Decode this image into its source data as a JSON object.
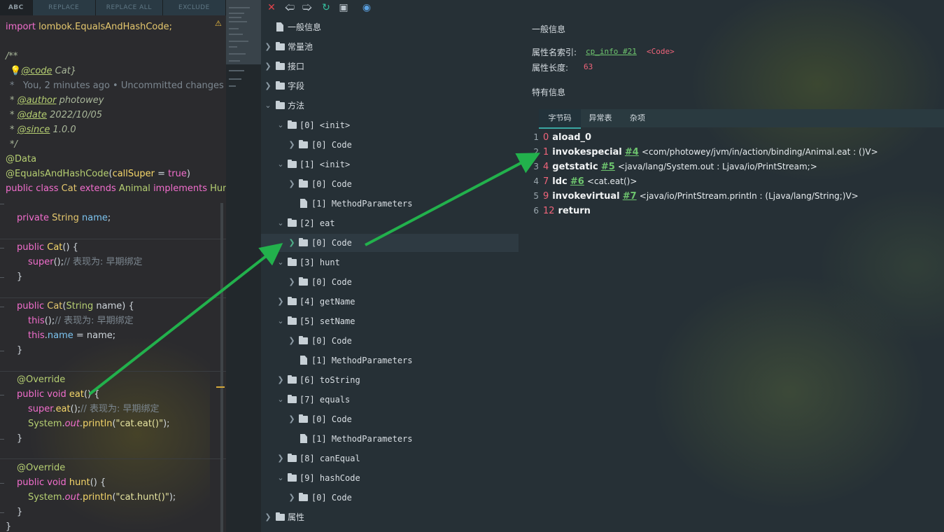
{
  "find_bar": {
    "abc": "ABC",
    "replace": "REPLACE",
    "replace_all": "REPLACE ALL",
    "exclude": "EXCLUDE"
  },
  "code": {
    "import_kw": "import",
    "import_path": " lombok.EqualsAndHashCode;",
    "doc_open": "/**",
    "doc_code_tag": "@code",
    "doc_code_val": " Cat}",
    "blame": "*   You, 2 minutes ago • Uncommitted changes",
    "author_tag": "@author",
    "author_val": " photowey",
    "date_tag": "@date",
    "date_val": " 2022/10/05",
    "since_tag": "@since",
    "since_val": " 1.0.0",
    "doc_close": "*/",
    "ann_data": "@Data",
    "ann_eq": "@EqualsAndHashCode",
    "ann_eq_arg_name": "callSuper",
    "ann_eq_arg_val": "true",
    "class_mod": "public class",
    "class_name": "Cat",
    "extends_kw": "extends",
    "super_name": "Animal",
    "impl_kw": "implements",
    "iface_name": "Hunt",
    "field_mod": "private",
    "field_type": "String",
    "field_name": "name",
    "ctor_mod": "public",
    "ctor_name": "Cat",
    "super_call": "super",
    "comment_early": "// 表现为: 早期绑定",
    "this_call": "this",
    "param_type": "String",
    "param_name": "name",
    "this_kw": "this",
    "override": "@Override",
    "void_kw": "public void",
    "eat": "eat",
    "hunt": "hunt",
    "system": "System",
    "out": "out",
    "println": "println",
    "str_eat": "\"cat.eat()\"",
    "str_hunt": "\"cat.hunt()\"",
    "close_brace": "}"
  },
  "tree": {
    "general": "一般信息",
    "const_pool": "常量池",
    "interfaces": "接口",
    "fields": "字段",
    "methods": "方法",
    "m0": "[0] <init>",
    "m0c": "[0] Code",
    "m1": "[1] <init>",
    "m1c": "[0] Code",
    "m1p": "[1] MethodParameters",
    "m2": "[2] eat",
    "m2c": "[0] Code",
    "m3": "[3] hunt",
    "m3c": "[0] Code",
    "m4": "[4] getName",
    "m5": "[5] setName",
    "m5c": "[0] Code",
    "m5p": "[1] MethodParameters",
    "m6": "[6] toString",
    "m7": "[7] equals",
    "m7c": "[0] Code",
    "m7p": "[1] MethodParameters",
    "m8": "[8] canEqual",
    "m9": "[9] hashCode",
    "m9c": "[0] Code",
    "attrs": "属性"
  },
  "panel": {
    "general_title": "一般信息",
    "name_index_label": "属性名索引:",
    "name_index_link": "cp_info #21",
    "name_index_val": "<Code>",
    "length_label": "属性长度:",
    "length_val": "63",
    "specific_title": "特有信息",
    "tabs": [
      "字节码",
      "异常表",
      "杂项"
    ]
  },
  "bytecode": [
    {
      "line": "1",
      "offset": "0",
      "op": "aload_0",
      "ref": "",
      "arg": ""
    },
    {
      "line": "2",
      "offset": "1",
      "op": "invokespecial",
      "ref": "#4",
      "arg": "<com/photowey/jvm/in/action/binding/Animal.eat : ()V>"
    },
    {
      "line": "3",
      "offset": "4",
      "op": "getstatic",
      "ref": "#5",
      "arg": "<java/lang/System.out : Ljava/io/PrintStream;>"
    },
    {
      "line": "4",
      "offset": "7",
      "op": "ldc",
      "ref": "#6",
      "arg": "<cat.eat()>"
    },
    {
      "line": "5",
      "offset": "9",
      "op": "invokevirtual",
      "ref": "#7",
      "arg": "<java/io/PrintStream.println : (Ljava/lang/String;)V>"
    },
    {
      "line": "6",
      "offset": "12",
      "op": "return",
      "ref": "",
      "arg": ""
    }
  ],
  "icons": {
    "close": "close-icon",
    "back": "arrow-left-icon",
    "forward": "arrow-right-icon",
    "refresh": "refresh-icon",
    "save": "save-icon",
    "globe": "globe-icon",
    "warning": "warning-icon"
  },
  "colors": {
    "arrow": "#22b14c",
    "link": "#6ec56e",
    "offset": "#f0647a",
    "keyword": "#f26ecd"
  }
}
